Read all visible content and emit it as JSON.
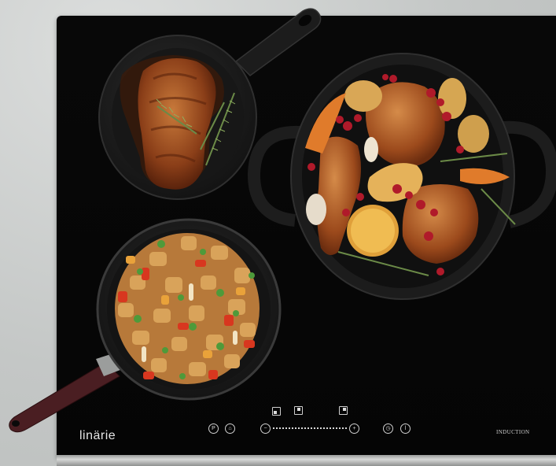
{
  "image": {
    "brand": "linärie",
    "label": "INDUCTION",
    "subjects": [
      "cast-iron-skillet-with-pork-chop",
      "cast-iron-pot-with-roast-chicken",
      "frying-pan-with-chicken-vegetable-stir-fry"
    ]
  },
  "controls": {
    "left_icons": [
      "p-icon",
      "lock-icon"
    ],
    "zone_icons": [
      "zone-front-left-icon",
      "zone-rear-center-icon",
      "zone-right-icon"
    ],
    "minus_icon": "minus-icon",
    "plus_icon": "plus-icon",
    "right_icons": [
      "timer-icon",
      "power-icon"
    ]
  },
  "colors": {
    "hob": "#060606",
    "counter": "#c7cac9",
    "pan": "#1e1e1e",
    "handle": "#4a1e22"
  }
}
